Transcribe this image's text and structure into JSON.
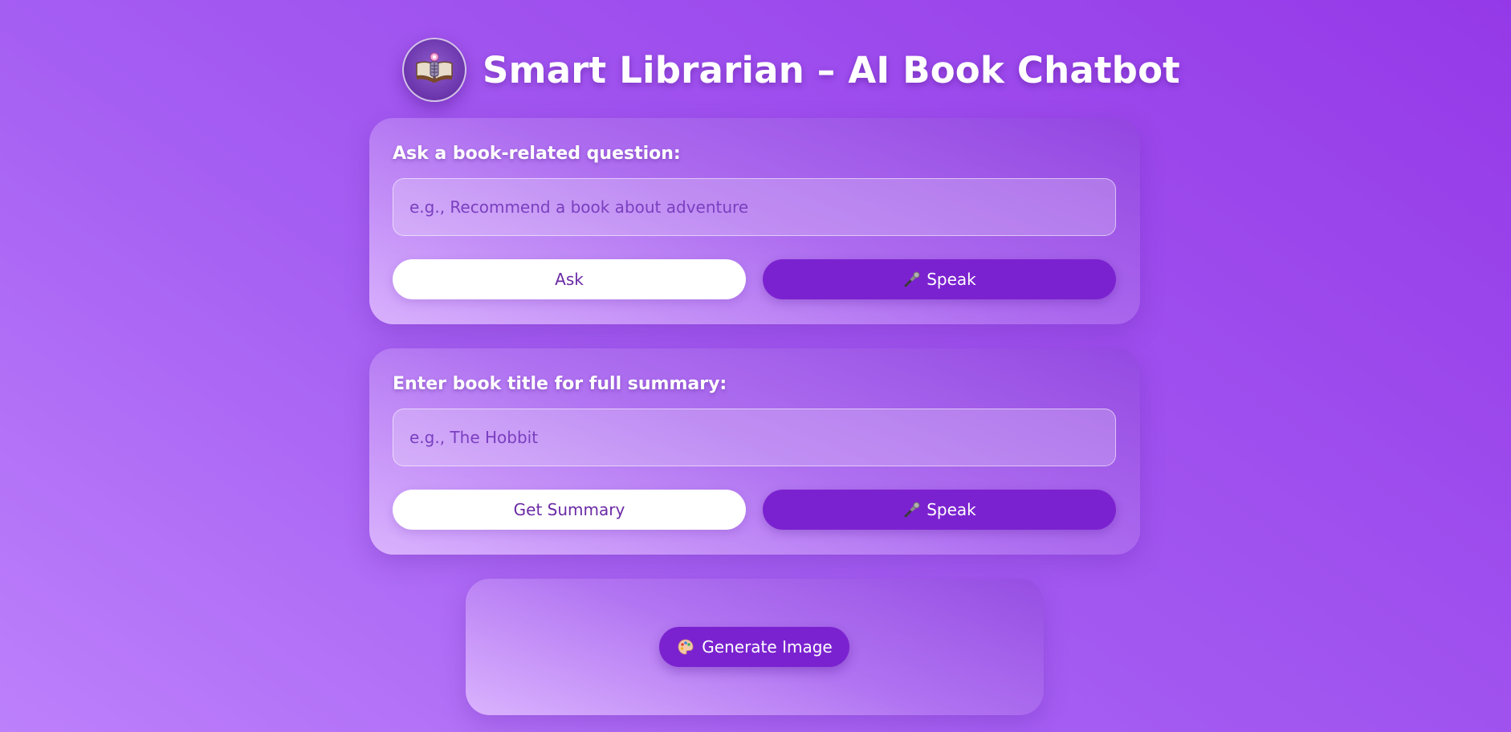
{
  "header": {
    "title": "Smart Librarian – AI Book Chatbot",
    "logo_icon": "open-book-robot-icon"
  },
  "question_section": {
    "label": "Ask a book-related question:",
    "input_value": "",
    "placeholder": "e.g., Recommend a book about adventure",
    "ask_label": "Ask",
    "speak_label": "Speak",
    "speak_icon": "microphone-icon"
  },
  "summary_section": {
    "label": "Enter book title for full summary:",
    "input_value": "",
    "placeholder": "e.g., The Hobbit",
    "summary_label": "Get Summary",
    "speak_label": "Speak",
    "speak_icon": "microphone-icon"
  },
  "image_section": {
    "generate_label": "Generate Image",
    "generate_icon": "palette-icon"
  },
  "colors": {
    "accent": "#7b22d0",
    "background_start": "#bd80fb",
    "background_end": "#9539e8",
    "button_text_dark": "#6a2aa5"
  }
}
